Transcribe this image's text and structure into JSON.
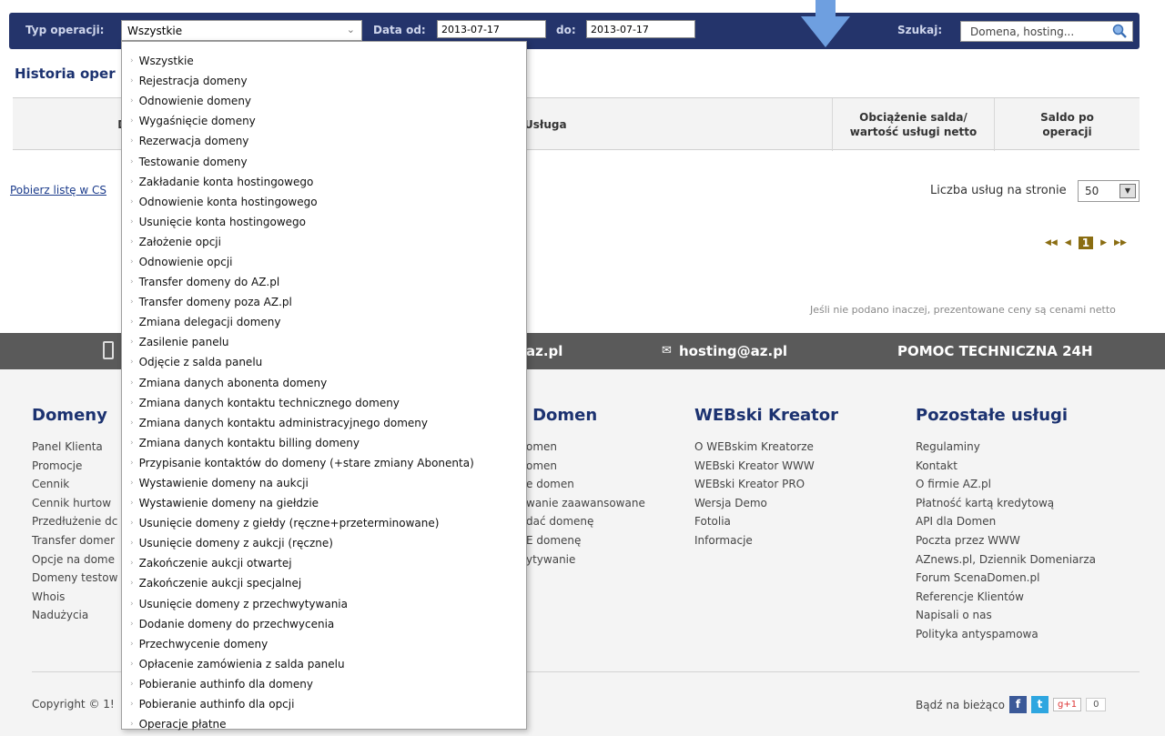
{
  "filter": {
    "type_label": "Typ operacji:",
    "type_value": "Wszystkie",
    "date_from_label": "Data od:",
    "date_from_value": "2013-07-17",
    "date_to_label": "do:",
    "date_to_value": "2013-07-17",
    "search_label": "Szukaj:",
    "search_placeholder": "Domena, hosting..."
  },
  "history": {
    "title": "Historia oper",
    "col_date": "Dat",
    "col_service": "Usługa",
    "col_charge": "Obciążenie salda/\nwartość usługi netto",
    "col_balance": "Saldo po\noperacji"
  },
  "csv_link": "Pobierz listę w CS",
  "per_page_label": "Liczba usług na stronie",
  "per_page_value": "50",
  "pager": {
    "first": "◀◀",
    "prev": "◀",
    "current": "1",
    "next": "▶",
    "last": "▶▶"
  },
  "price_note": "Jeśli nie podano inaczej, prezentowane ceny są cenami netto",
  "band": {
    "email1": "az.pl",
    "email2": "hosting@az.pl",
    "support": "POMOC TECHNICZNA 24H"
  },
  "footer": {
    "domeny": {
      "title": "Domeny",
      "links": [
        "Panel Klienta",
        "Promocje",
        "Cennik",
        "Cennik hurtow",
        "Przedłużenie dc",
        "Transfer domer",
        "Opcje na dome",
        "Domeny testow",
        "Whois",
        "Nadużycia"
      ]
    },
    "rynek": {
      "title": "n Domen",
      "links": [
        "omen",
        "omen",
        "e domen",
        "wanie zaawansowane",
        "dać domenę",
        "E domenę",
        "ytywanie"
      ]
    },
    "webski": {
      "title": "WEBski Kreator",
      "links": [
        "O WEBskim Kreatorze",
        "WEBski Kreator WWW",
        "WEBski Kreator PRO",
        "Wersja Demo",
        "Fotolia",
        "Informacje"
      ]
    },
    "pozostale": {
      "title": "Pozostałe usługi",
      "links": [
        "Regulaminy",
        "Kontakt",
        "O firmie AZ.pl",
        "Płatność kartą kredytową",
        "API dla Domen",
        "Poczta przez WWW",
        "AZnews.pl, Dziennik Domeniarza",
        "Forum ScenaDomen.pl",
        "Referencje Klientów",
        "Napisali o nas",
        "Polityka antyspamowa"
      ]
    },
    "copyright": "Copyright © 1!",
    "social_label": "Bądź na bieżąco",
    "gplus": "g+1",
    "gcount": "0"
  },
  "dropdown": {
    "options": [
      "Wszystkie",
      "Rejestracja domeny",
      "Odnowienie domeny",
      "Wygaśnięcie domeny",
      "Rezerwacja domeny",
      "Testowanie domeny",
      "Zakładanie konta hostingowego",
      "Odnowienie konta hostingowego",
      "Usunięcie konta hostingowego",
      "Założenie opcji",
      "Odnowienie opcji",
      "Transfer domeny do AZ.pl",
      "Transfer domeny poza AZ.pl",
      "Zmiana delegacji domeny",
      "Zasilenie panelu",
      "Odjęcie z salda panelu",
      "Zmiana danych abonenta domeny",
      "Zmiana danych kontaktu technicznego domeny",
      "Zmiana danych kontaktu administracyjnego domeny",
      "Zmiana danych kontaktu billing domeny",
      "Przypisanie kontaktów do domeny (+stare zmiany Abonenta)",
      "Wystawienie domeny na aukcji",
      "Wystawienie domeny na giełdzie",
      "Usunięcie domeny z giełdy (ręczne+przeterminowane)",
      "Usunięcie domeny z aukcji (ręczne)",
      "Zakończenie aukcji otwartej",
      "Zakończenie aukcji specjalnej",
      "Usunięcie domeny z przechwytywania",
      "Dodanie domeny do przechwycenia",
      "Przechwycenie domeny",
      "Opłacenie zamówienia z salda panelu",
      "Pobieranie authinfo dla domeny",
      "Pobieranie authinfo dla opcji",
      "Operacje płatne"
    ]
  },
  "colors": {
    "navy": "#24346b",
    "gold": "#8a6d12",
    "arrow": "#6e9fe0"
  }
}
